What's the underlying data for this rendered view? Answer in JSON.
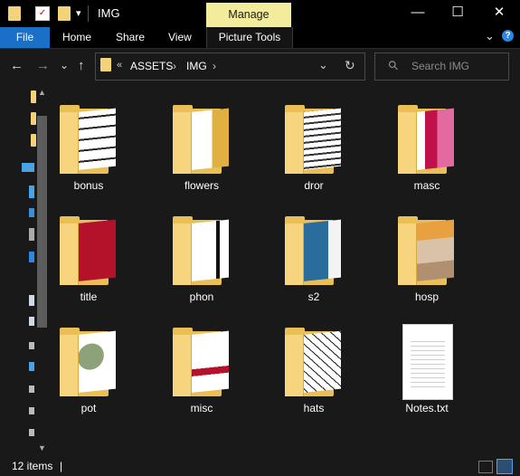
{
  "window": {
    "title": "IMG",
    "manage_tab": "Manage",
    "minimize_glyph": "—",
    "maximize_glyph": "☐",
    "close_glyph": "✕",
    "quick_access_dropdown_glyph": "▾"
  },
  "ribbon": {
    "tabs": [
      "File",
      "Home",
      "Share",
      "View",
      "Picture Tools"
    ],
    "expand_glyph": "⌄",
    "help_glyph": "?"
  },
  "nav": {
    "back_glyph": "←",
    "forward_glyph": "→",
    "recent_glyph": "⌄",
    "up_glyph": "↑",
    "breadcrumb_overflow": "«",
    "breadcrumb": [
      "ASSETS",
      "IMG"
    ],
    "separator": "›",
    "dropdown_glyph": "⌄",
    "refresh_glyph": "↻",
    "search_placeholder": "Search IMG",
    "search_glyph": "⚲"
  },
  "items": [
    {
      "name": "bonus",
      "type": "folder",
      "thumb": "text"
    },
    {
      "name": "flowers",
      "type": "folder",
      "thumb": "drawing"
    },
    {
      "name": "dror",
      "type": "folder",
      "thumb": "text2"
    },
    {
      "name": "masc",
      "type": "folder",
      "thumb": "pinkred"
    },
    {
      "name": "title",
      "type": "folder",
      "thumb": "red"
    },
    {
      "name": "phon",
      "type": "folder",
      "thumb": "white"
    },
    {
      "name": "s2",
      "type": "folder",
      "thumb": "blue"
    },
    {
      "name": "hosp",
      "type": "folder",
      "thumb": "collage"
    },
    {
      "name": "pot",
      "type": "folder",
      "thumb": "green"
    },
    {
      "name": "misc",
      "type": "folder",
      "thumb": "white2"
    },
    {
      "name": "hats",
      "type": "folder",
      "thumb": "sketch"
    },
    {
      "name": "Notes.txt",
      "type": "text-file"
    }
  ],
  "status": {
    "item_count": "12 items",
    "cursor": "|"
  },
  "colors": {
    "file_tab": "#1a6fc6",
    "manage_tab": "#f2ec9c",
    "folder": "#e9bf56",
    "background": "#191919"
  }
}
